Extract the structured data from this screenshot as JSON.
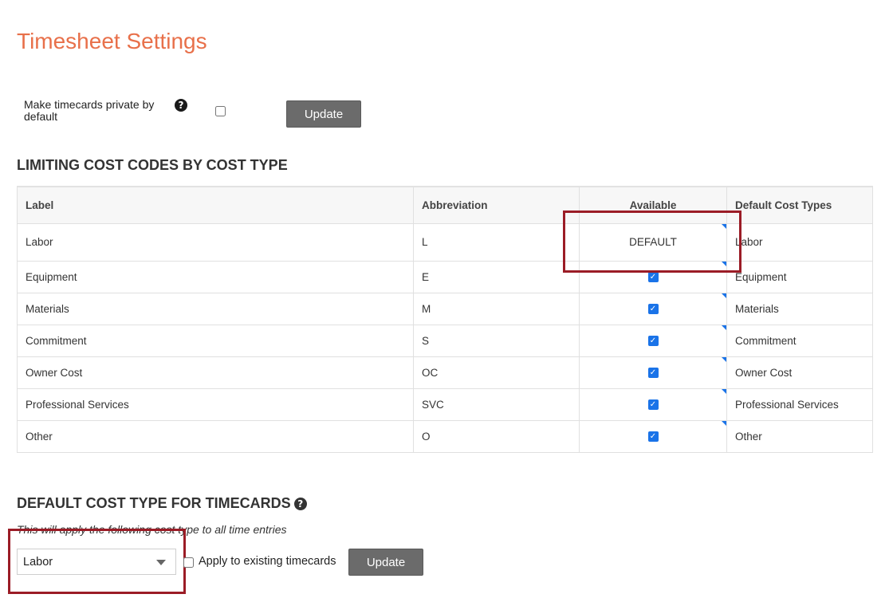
{
  "page": {
    "title": "Timesheet Settings"
  },
  "private_setting": {
    "label": "Make timecards private by default",
    "help_icon": "question-circle-icon",
    "checked": false,
    "update_label": "Update"
  },
  "limiting": {
    "heading": "LIMITING COST CODES BY COST TYPE",
    "columns": {
      "label": "Label",
      "abbreviation": "Abbreviation",
      "available": "Available",
      "default_cost_types": "Default Cost Types"
    },
    "rows": [
      {
        "label": "Labor",
        "abbreviation": "L",
        "available": "DEFAULT",
        "default_cost_type": "Labor"
      },
      {
        "label": "Equipment",
        "abbreviation": "E",
        "available": true,
        "default_cost_type": "Equipment"
      },
      {
        "label": "Materials",
        "abbreviation": "M",
        "available": true,
        "default_cost_type": "Materials"
      },
      {
        "label": "Commitment",
        "abbreviation": "S",
        "available": true,
        "default_cost_type": "Commitment"
      },
      {
        "label": "Owner Cost",
        "abbreviation": "OC",
        "available": true,
        "default_cost_type": "Owner Cost"
      },
      {
        "label": "Professional Services",
        "abbreviation": "SVC",
        "available": true,
        "default_cost_type": "Professional Services"
      },
      {
        "label": "Other",
        "abbreviation": "O",
        "available": true,
        "default_cost_type": "Other"
      }
    ]
  },
  "default_cost_type": {
    "heading": "DEFAULT COST TYPE FOR TIMECARDS",
    "help_icon": "question-circle-icon",
    "subtext": "This will apply the following cost type to all time entries",
    "selected": "Labor",
    "apply_label": "Apply to existing timecards",
    "apply_checked": false,
    "update_label": "Update"
  },
  "colors": {
    "title": "#e8704a",
    "highlight": "#9b1c26",
    "button": "#6b6b6b",
    "check": "#1a73e8"
  }
}
